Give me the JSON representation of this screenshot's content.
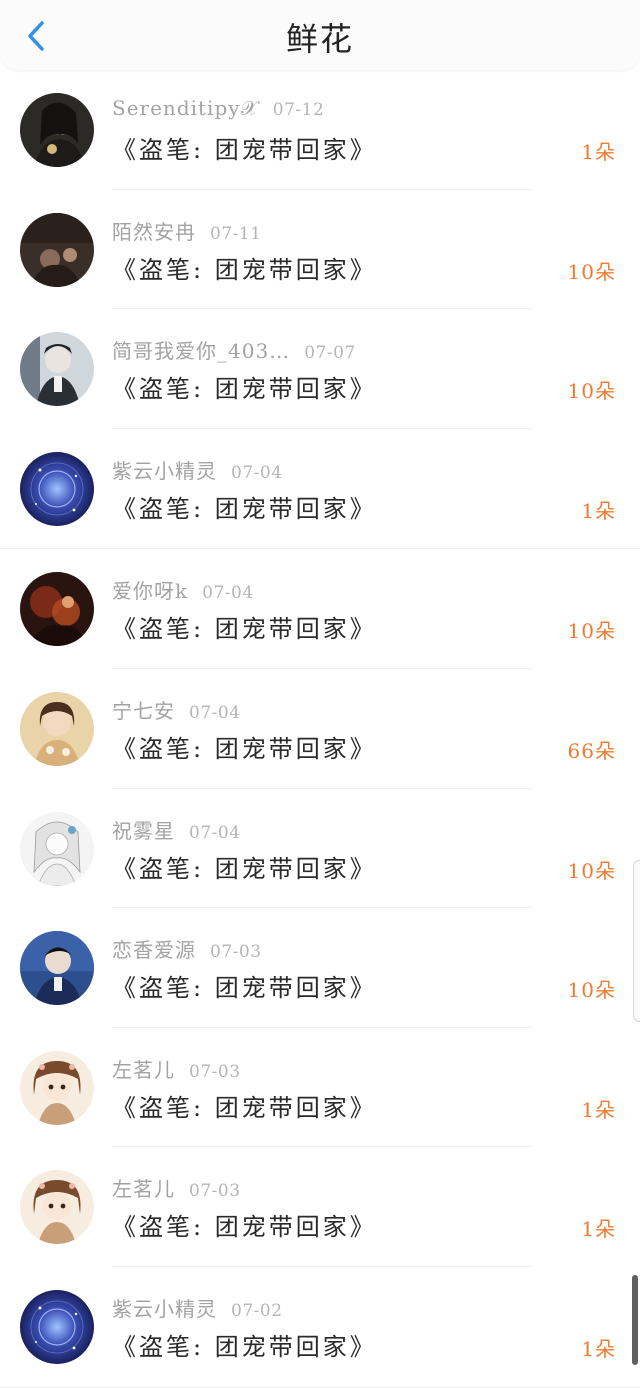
{
  "header": {
    "title": "鲜花"
  },
  "colors": {
    "accent": "#2d8ff0",
    "count": "#f07a2e"
  },
  "rows": [
    {
      "user": "Serenditipy𝒳",
      "date": "07-12",
      "book": "《盗笔:  团宠带回家》",
      "count": "1朵",
      "avatar": "dark-portrait"
    },
    {
      "user": "陌然安冉",
      "date": "07-11",
      "book": "《盗笔:  团宠带回家》",
      "count": "10朵",
      "avatar": "dark-scene"
    },
    {
      "user": "简哥我爱你_403…",
      "date": "07-07",
      "book": "《盗笔:  团宠带回家》",
      "count": "10朵",
      "avatar": "boy-portrait"
    },
    {
      "user": "紫云小精灵",
      "date": "07-04",
      "book": "《盗笔:  团宠带回家》",
      "count": "1朵",
      "avatar": "galaxy"
    },
    {
      "user": "爱你呀k",
      "date": "07-04",
      "book": "《盗笔:  团宠带回家》",
      "count": "10朵",
      "avatar": "red-dark"
    },
    {
      "user": "宁七安",
      "date": "07-04",
      "book": "《盗笔:  团宠带回家》",
      "count": "66朵",
      "avatar": "girl-portrait"
    },
    {
      "user": "祝雾星",
      "date": "07-04",
      "book": "《盗笔:  团宠带回家》",
      "count": "10朵",
      "avatar": "sketch-girl"
    },
    {
      "user": "恋香爱源",
      "date": "07-03",
      "book": "《盗笔:  团宠带回家》",
      "count": "10朵",
      "avatar": "blue-boy"
    },
    {
      "user": "左茗儿",
      "date": "07-03",
      "book": "《盗笔:  团宠带回家》",
      "count": "1朵",
      "avatar": "anime-girl"
    },
    {
      "user": "左茗儿",
      "date": "07-03",
      "book": "《盗笔:  团宠带回家》",
      "count": "1朵",
      "avatar": "anime-girl"
    },
    {
      "user": "紫云小精灵",
      "date": "07-02",
      "book": "《盗笔:  团宠带回家》",
      "count": "1朵",
      "avatar": "galaxy"
    }
  ]
}
